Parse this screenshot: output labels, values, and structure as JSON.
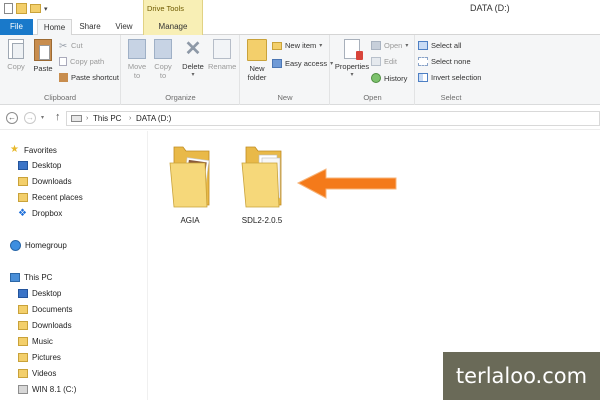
{
  "window": {
    "title": "DATA (D:)",
    "context_tab_group": "Drive Tools"
  },
  "tabs": [
    "File",
    "Home",
    "Share",
    "View",
    "Manage"
  ],
  "ribbon": {
    "clipboard": {
      "label": "Clipboard",
      "copy": "Copy",
      "paste": "Paste",
      "cut": "Cut",
      "copy_path": "Copy path",
      "paste_shortcut": "Paste shortcut"
    },
    "organize": {
      "label": "Organize",
      "move_to_1": "Move",
      "move_to_2": "to",
      "copy_to_1": "Copy",
      "copy_to_2": "to",
      "delete": "Delete",
      "rename": "Rename"
    },
    "new": {
      "label": "New",
      "new_item": "New item",
      "easy_access": "Easy access",
      "new_folder_1": "New",
      "new_folder_2": "folder"
    },
    "open": {
      "label": "Open",
      "properties": "Properties",
      "open": "Open",
      "edit": "Edit",
      "history": "History"
    },
    "select": {
      "label": "Select",
      "select_all": "Select all",
      "select_none": "Select none",
      "invert_selection": "Invert selection"
    }
  },
  "address": {
    "crumbs": [
      "This PC",
      "DATA (D:)"
    ]
  },
  "sidebar": {
    "favorites": {
      "label": "Favorites",
      "items": [
        "Desktop",
        "Downloads",
        "Recent places",
        "Dropbox"
      ]
    },
    "homegroup": "Homegroup",
    "this_pc": {
      "label": "This PC",
      "items": [
        "Desktop",
        "Documents",
        "Downloads",
        "Music",
        "Pictures",
        "Videos",
        "WIN 8.1 (C:)"
      ]
    }
  },
  "files": [
    {
      "name": "AGIA"
    },
    {
      "name": "SDL2-2.0.5"
    }
  ],
  "watermark": "terlaloo.com",
  "colors": {
    "file_tab": "#1979ca",
    "drive_tools": "#f8efb5",
    "arrow": "#f47a1a",
    "folder": "#f3cf6b"
  }
}
